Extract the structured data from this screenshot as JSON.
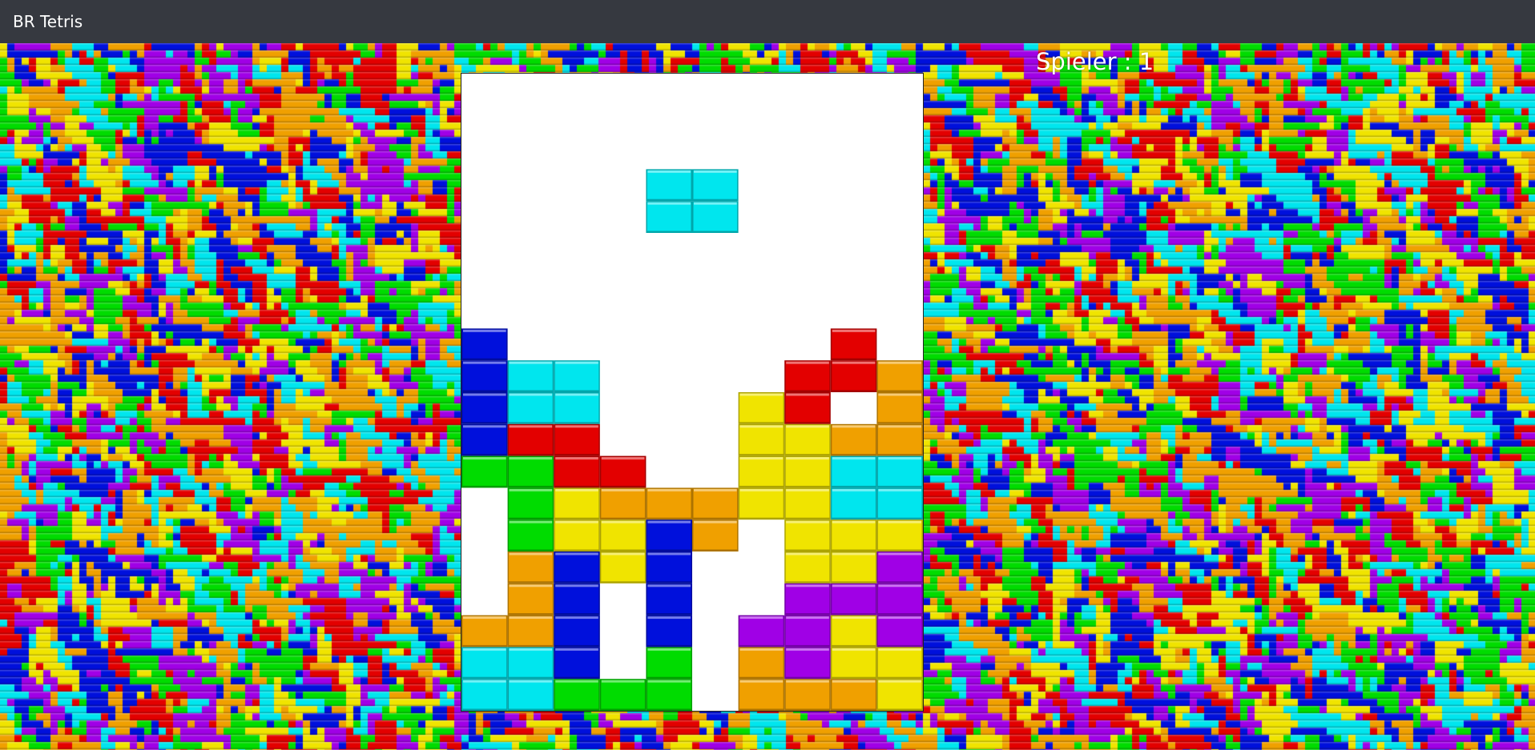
{
  "app": {
    "title": "BR Tetris"
  },
  "game": {
    "player_label": "Spieler : 1",
    "board_cols": 10,
    "board_rows": 20,
    "colors": {
      "B": "#0010dc",
      "C": "#00e6ee",
      "R": "#e30000",
      "G": "#00dc00",
      "Y": "#f0e400",
      "O": "#f0a000",
      "P": "#a000e6"
    },
    "active_piece": {
      "type": "O",
      "color": "C",
      "cells": [
        [
          4,
          3
        ],
        [
          5,
          3
        ],
        [
          4,
          4
        ],
        [
          5,
          4
        ]
      ]
    },
    "stack": [
      "..........",
      "..........",
      "..........",
      "..........",
      "..........",
      "..........",
      "..........",
      "..........",
      "B.......R.",
      "BCC....RRO",
      "BCC...YR.O",
      "BRR...YYOO",
      "GGRR..YYCC",
      ".GYOOOYYCC",
      ".GYYBO.YYY",
      ".OBYB..YYP",
      ".OB.B..PPP",
      "OOB.B.PPYP",
      "CCB.G.OPYY",
      "CCGGG.OOOY"
    ]
  }
}
